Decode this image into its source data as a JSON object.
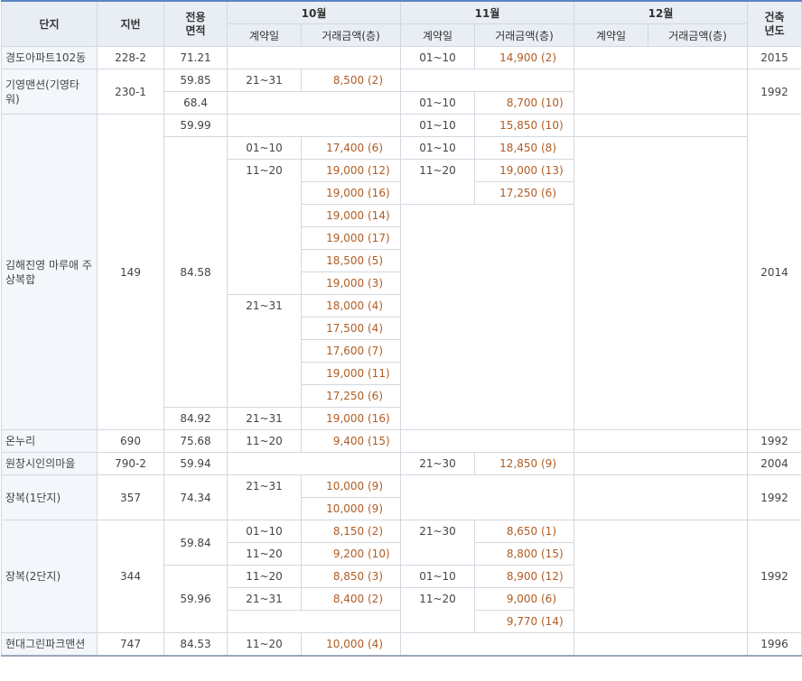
{
  "header": {
    "complex": "단지",
    "lot": "지번",
    "area": "전용\n면적",
    "months": [
      "10월",
      "11월",
      "12월"
    ],
    "contract_day": "계약일",
    "amount_floor": "거래금액(층)",
    "built": "건축\n년도"
  },
  "rows": [
    {
      "name": "경도아파트102동",
      "lot": "228-2",
      "area": "71.21",
      "d10": "",
      "a10": "",
      "f10": "",
      "d11": "01~10",
      "a11": "14,900",
      "f11": "(2)",
      "d12": "",
      "a12": "",
      "f12": "",
      "built": "2015"
    },
    {
      "name": "기영맨션(기영타워)",
      "lot": "230-1",
      "area": "59.85",
      "d10": "21~31",
      "a10": "8,500",
      "f10": "(2)",
      "d11": "",
      "a11": "",
      "f11": "",
      "d12": "",
      "a12": "",
      "f12": "",
      "built": "1992"
    },
    {
      "name": "",
      "lot": "",
      "area": "68.4",
      "d10": "",
      "a10": "",
      "f10": "",
      "d11": "01~10",
      "a11": "8,700",
      "f11": "(10)",
      "d12": "",
      "a12": "",
      "f12": "",
      "built": ""
    },
    {
      "name": "김해진영 마루애 주상복합",
      "lot": "149",
      "area": "59.99",
      "d10": "",
      "a10": "",
      "f10": "",
      "d11": "01~10",
      "a11": "15,850",
      "f11": "(10)",
      "d12": "",
      "a12": "",
      "f12": "",
      "built": "2014"
    },
    {
      "name": "",
      "lot": "",
      "area": "84.58",
      "d10": "01~10",
      "a10": "17,400",
      "f10": "(6)",
      "d11": "01~10",
      "a11": "18,450",
      "f11": "(8)",
      "d12": "",
      "a12": "",
      "f12": "",
      "built": ""
    },
    {
      "name": "",
      "lot": "",
      "area": "",
      "d10": "11~20",
      "a10": "19,000",
      "f10": "(12)",
      "d11": "11~20",
      "a11": "19,000",
      "f11": "(13)",
      "d12": "",
      "a12": "",
      "f12": "",
      "built": ""
    },
    {
      "name": "",
      "lot": "",
      "area": "",
      "d10": "",
      "a10": "19,000",
      "f10": "(16)",
      "d11": "",
      "a11": "17,250",
      "f11": "(6)",
      "d12": "",
      "a12": "",
      "f12": "",
      "built": ""
    },
    {
      "name": "",
      "lot": "",
      "area": "",
      "d10": "",
      "a10": "19,000",
      "f10": "(14)",
      "d11": "",
      "a11": "",
      "f11": "",
      "d12": "",
      "a12": "",
      "f12": "",
      "built": ""
    },
    {
      "name": "",
      "lot": "",
      "area": "",
      "d10": "",
      "a10": "19,000",
      "f10": "(17)",
      "d11": "",
      "a11": "",
      "f11": "",
      "d12": "",
      "a12": "",
      "f12": "",
      "built": ""
    },
    {
      "name": "",
      "lot": "",
      "area": "",
      "d10": "",
      "a10": "18,500",
      "f10": "(5)",
      "d11": "",
      "a11": "",
      "f11": "",
      "d12": "",
      "a12": "",
      "f12": "",
      "built": ""
    },
    {
      "name": "",
      "lot": "",
      "area": "",
      "d10": "",
      "a10": "19,000",
      "f10": "(3)",
      "d11": "",
      "a11": "",
      "f11": "",
      "d12": "",
      "a12": "",
      "f12": "",
      "built": ""
    },
    {
      "name": "",
      "lot": "",
      "area": "",
      "d10": "21~31",
      "a10": "18,000",
      "f10": "(4)",
      "d11": "",
      "a11": "",
      "f11": "",
      "d12": "",
      "a12": "",
      "f12": "",
      "built": ""
    },
    {
      "name": "",
      "lot": "",
      "area": "",
      "d10": "",
      "a10": "17,500",
      "f10": "(4)",
      "d11": "",
      "a11": "",
      "f11": "",
      "d12": "",
      "a12": "",
      "f12": "",
      "built": ""
    },
    {
      "name": "",
      "lot": "",
      "area": "",
      "d10": "",
      "a10": "17,600",
      "f10": "(7)",
      "d11": "",
      "a11": "",
      "f11": "",
      "d12": "",
      "a12": "",
      "f12": "",
      "built": ""
    },
    {
      "name": "",
      "lot": "",
      "area": "",
      "d10": "",
      "a10": "19,000",
      "f10": "(11)",
      "d11": "",
      "a11": "",
      "f11": "",
      "d12": "",
      "a12": "",
      "f12": "",
      "built": ""
    },
    {
      "name": "",
      "lot": "",
      "area": "",
      "d10": "",
      "a10": "17,250",
      "f10": "(6)",
      "d11": "",
      "a11": "",
      "f11": "",
      "d12": "",
      "a12": "",
      "f12": "",
      "built": ""
    },
    {
      "name": "",
      "lot": "",
      "area": "84.92",
      "d10": "21~31",
      "a10": "19,000",
      "f10": "(16)",
      "d11": "",
      "a11": "",
      "f11": "",
      "d12": "",
      "a12": "",
      "f12": "",
      "built": ""
    },
    {
      "name": "온누리",
      "lot": "690",
      "area": "75.68",
      "d10": "11~20",
      "a10": "9,400",
      "f10": "(15)",
      "d11": "",
      "a11": "",
      "f11": "",
      "d12": "",
      "a12": "",
      "f12": "",
      "built": "1992"
    },
    {
      "name": "원창시인의마을",
      "lot": "790-2",
      "area": "59.94",
      "d10": "",
      "a10": "",
      "f10": "",
      "d11": "21~30",
      "a11": "12,850",
      "f11": "(9)",
      "d12": "",
      "a12": "",
      "f12": "",
      "built": "2004"
    },
    {
      "name": "장복(1단지)",
      "lot": "357",
      "area": "74.34",
      "d10": "21~31",
      "a10": "10,000",
      "f10": "(9)",
      "d11": "",
      "a11": "",
      "f11": "",
      "d12": "",
      "a12": "",
      "f12": "",
      "built": "1992"
    },
    {
      "name": "",
      "lot": "",
      "area": "",
      "d10": "",
      "a10": "10,000",
      "f10": "(9)",
      "d11": "",
      "a11": "",
      "f11": "",
      "d12": "",
      "a12": "",
      "f12": "",
      "built": ""
    },
    {
      "name": "장복(2단지)",
      "lot": "344",
      "area": "59.84",
      "d10": "01~10",
      "a10": "8,150",
      "f10": "(2)",
      "d11": "21~30",
      "a11": "8,650",
      "f11": "(1)",
      "d12": "",
      "a12": "",
      "f12": "",
      "built": "1992"
    },
    {
      "name": "",
      "lot": "",
      "area": "",
      "d10": "11~20",
      "a10": "9,200",
      "f10": "(10)",
      "d11": "",
      "a11": "8,800",
      "f11": "(15)",
      "d12": "",
      "a12": "",
      "f12": "",
      "built": ""
    },
    {
      "name": "",
      "lot": "",
      "area": "59.96",
      "d10": "11~20",
      "a10": "8,850",
      "f10": "(3)",
      "d11": "01~10",
      "a11": "8,900",
      "f11": "(12)",
      "d12": "",
      "a12": "",
      "f12": "",
      "built": ""
    },
    {
      "name": "",
      "lot": "",
      "area": "",
      "d10": "21~31",
      "a10": "8,400",
      "f10": "(2)",
      "d11": "11~20",
      "a11": "9,000",
      "f11": "(6)",
      "d12": "",
      "a12": "",
      "f12": "",
      "built": ""
    },
    {
      "name": "",
      "lot": "",
      "area": "",
      "d10": "",
      "a10": "",
      "f10": "",
      "d11": "",
      "a11": "9,770",
      "f11": "(14)",
      "d12": "",
      "a12": "",
      "f12": "",
      "built": ""
    },
    {
      "name": "현대그린파크맨션",
      "lot": "747",
      "area": "84.53",
      "d10": "11~20",
      "a10": "10,000",
      "f10": "(4)",
      "d11": "",
      "a11": "",
      "f11": "",
      "d12": "",
      "a12": "",
      "f12": "",
      "built": "1996"
    }
  ]
}
